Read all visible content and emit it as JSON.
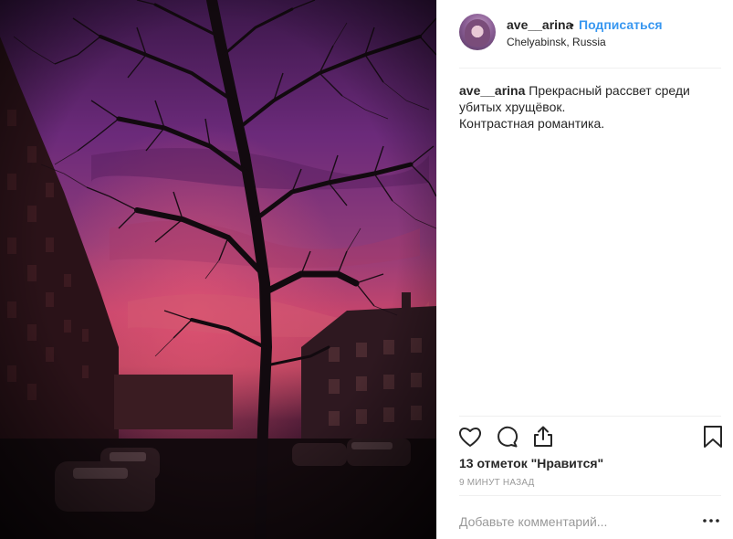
{
  "post": {
    "username": "ave__arina",
    "follow_label": "Подписаться",
    "separator_dot": "•",
    "location": "Chelyabinsk, Russia",
    "caption_user": "ave__arina",
    "caption_lines": [
      "Прекрасный рассвет среди",
      "убитых хрущёвок.",
      "Контрастная романтика."
    ],
    "likes_text": "13 отметок \"Нравится\"",
    "time_text": "9 МИНУТ НАЗАД",
    "comment_placeholder": "Добавьте комментарий..."
  },
  "icons": {
    "like": "heart-icon",
    "comment": "comment-bubble-icon",
    "share": "share-icon",
    "save": "bookmark-icon",
    "more": "more-options-icon"
  },
  "colors": {
    "link": "#3897f0",
    "text": "#262626",
    "muted": "#999999",
    "divider": "#efefef"
  }
}
